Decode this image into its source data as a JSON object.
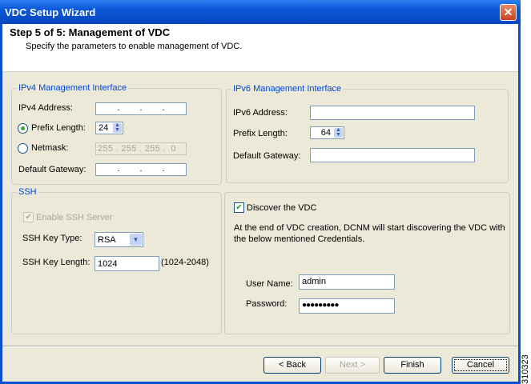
{
  "window": {
    "title": "VDC Setup Wizard",
    "close_icon": "close-icon"
  },
  "header": {
    "title": "Step 5 of 5: Management of VDC",
    "subtitle": "Specify the parameters to enable management of VDC."
  },
  "ipv4": {
    "legend": "IPv4 Management Interface",
    "address_label": "IPv4 Address:",
    "address_dots": [
      ".",
      ".",
      "."
    ],
    "prefix_label": "Prefix Length:",
    "prefix_value": "24",
    "netmask_label": "Netmask:",
    "netmask_octets": [
      "255",
      ".",
      "255",
      ".",
      "255",
      ".",
      "0"
    ],
    "gateway_label": "Default Gateway:",
    "gateway_dots": [
      ".",
      ".",
      "."
    ],
    "selected": "prefix"
  },
  "ipv6": {
    "legend": "IPv6 Management Interface",
    "address_label": "IPv6 Address:",
    "address_value": "",
    "prefix_label": "Prefix Length:",
    "prefix_value": "64",
    "gateway_label": "Default Gateway:",
    "gateway_value": ""
  },
  "ssh": {
    "legend": "SSH",
    "enable_label": "Enable SSH Server",
    "enable_checked": true,
    "key_type_label": "SSH Key Type:",
    "key_type_value": "RSA",
    "key_length_label": "SSH Key Length:",
    "key_length_value": "1024",
    "key_length_range": "(1024-2048)"
  },
  "discover": {
    "label": "Discover the VDC",
    "checked": true,
    "description": "At the end of VDC creation, DCNM will start discovering the VDC with the below mentioned Credentials.",
    "username_label": "User Name:",
    "username_value": "admin",
    "password_label": "Password:",
    "password_value": "●●●●●●●●●"
  },
  "buttons": {
    "back": "< Back",
    "next": "Next >",
    "finish": "Finish",
    "cancel": "Cancel"
  },
  "side_id": "310323"
}
